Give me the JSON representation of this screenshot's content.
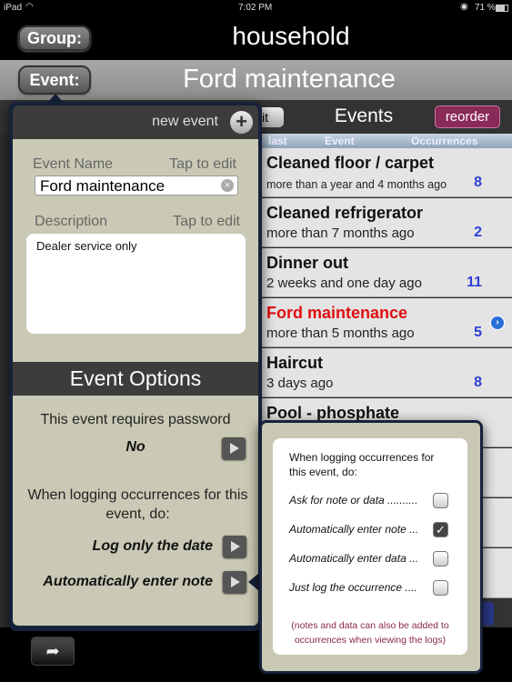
{
  "status_bar": {
    "device": "iPad",
    "time": "7:02 PM",
    "battery": "71 %"
  },
  "header": {
    "group_button": "Group:",
    "group_title": "household",
    "event_button": "Event:",
    "event_title": "Ford maintenance"
  },
  "toolbar": {
    "edit_label": "it",
    "title": "Events",
    "reorder_label": "reorder"
  },
  "columns": [
    "last",
    "Event",
    "Occurrences"
  ],
  "events": [
    {
      "name": "Cleaned floor / carpet",
      "last": "more than a year and 4 months ago",
      "count": "8"
    },
    {
      "name": "Cleaned refrigerator",
      "last": "more than 7 months ago",
      "count": "2"
    },
    {
      "name": "Dinner out",
      "last": "2 weeks and one day ago",
      "count": "11"
    },
    {
      "name": "Ford maintenance",
      "last": "more than 5 months ago",
      "count": "5",
      "selected": true
    },
    {
      "name": "Haircut",
      "last": "3 days ago",
      "count": "8"
    },
    {
      "name": "Pool - phosphate",
      "last": "",
      "count": ""
    }
  ],
  "event_popover": {
    "new_event_label": "new event",
    "event_name_label": "Event Name",
    "tap_to_edit": "Tap to edit",
    "event_name_value": "Ford maintenance",
    "description_label": "Description",
    "description_value": "Dealer service only",
    "options_title": "Event Options",
    "password_label": "This event requires password",
    "password_value": "No",
    "logging_label": "When logging occurrences for this event, do:",
    "logging_value_1": "Log only the date",
    "logging_value_2": "Automatically enter note"
  },
  "logging_popover": {
    "title": "When logging occurrences for this event, do:",
    "options": [
      {
        "label": "Ask for note or data ..........",
        "checked": false
      },
      {
        "label": "Automatically enter note ...",
        "checked": true
      },
      {
        "label": "Automatically enter data ...",
        "checked": false
      },
      {
        "label": "Just log the occurrence ....",
        "checked": false
      }
    ],
    "footnote": "(notes and data can also be added to occurrences when viewing the logs)"
  },
  "colors": {
    "selected_event": "#e01010",
    "count": "#2b3fd8",
    "reorder": "#8a2a58",
    "footnote": "#8a2a40"
  }
}
